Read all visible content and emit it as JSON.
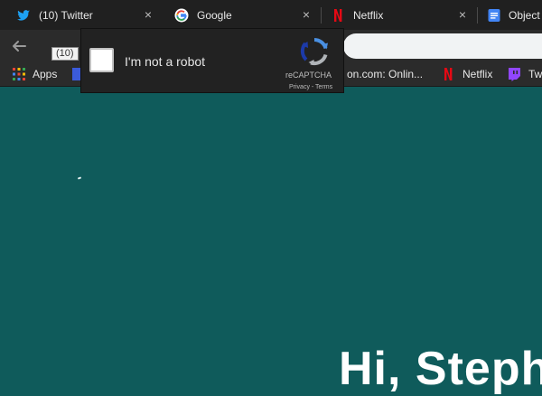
{
  "tabs": [
    {
      "title": "(10) Twitter",
      "icon": "twitter-icon"
    },
    {
      "title": "Google",
      "icon": "google-icon"
    },
    {
      "title": "Netflix",
      "icon": "netflix-icon"
    },
    {
      "title": "Object",
      "icon": "docs-icon"
    }
  ],
  "tab_close_glyph": "×",
  "tooltip": "(10)",
  "bookmarks": [
    {
      "label": "Apps",
      "icon": "apps-grid-icon"
    },
    {
      "label": "on.com: Onlin...",
      "icon": "amazon-icon"
    },
    {
      "label": "Netflix",
      "icon": "netflix-icon"
    },
    {
      "label": "Tw",
      "icon": "twitch-icon"
    }
  ],
  "recaptcha": {
    "label": "I'm not a robot",
    "brand": "reCAPTCHA",
    "links": "Privacy - Terms"
  },
  "hero": {
    "text": "Hi, Steph"
  },
  "colors": {
    "background": "#0f5b5b",
    "chrome_dark": "#202020",
    "twitter_blue": "#1da1f2",
    "netflix_red": "#e50914",
    "twitch_purple": "#9146ff"
  }
}
